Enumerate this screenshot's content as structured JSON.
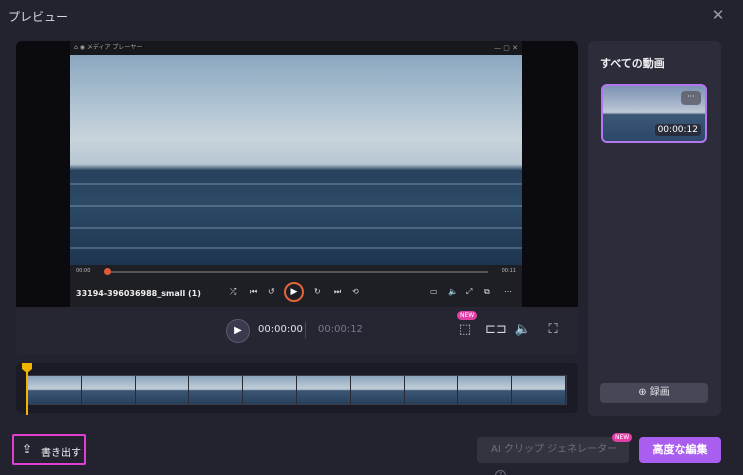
{
  "window": {
    "title": "プレビュー"
  },
  "player": {
    "inner_title": "メディア プレーヤー",
    "inner_time_start": "00:00",
    "inner_time_end": "00:11",
    "file_name": "33194-396036988_small (1)",
    "progress_fraction": 0.0
  },
  "controls": {
    "current_time": "00:00:00",
    "total_time": "00:00:12",
    "new_badge": "NEW"
  },
  "sidebar": {
    "title": "すべての動画",
    "thumbnail_duration": "00:00:12",
    "more_label": "···",
    "record_label": "⊕ 録画"
  },
  "footer": {
    "export_label": "書き出す",
    "ai_clip_label": "AI クリップ ジェネレーター",
    "ai_help": "?",
    "ai_new_badge": "NEW",
    "advanced_edit_label": "高度な編集"
  },
  "colors": {
    "accent": "#a95ef0",
    "badge": "#e13fa6",
    "playhead": "#f0b400",
    "export_border": "#e13fd0"
  }
}
